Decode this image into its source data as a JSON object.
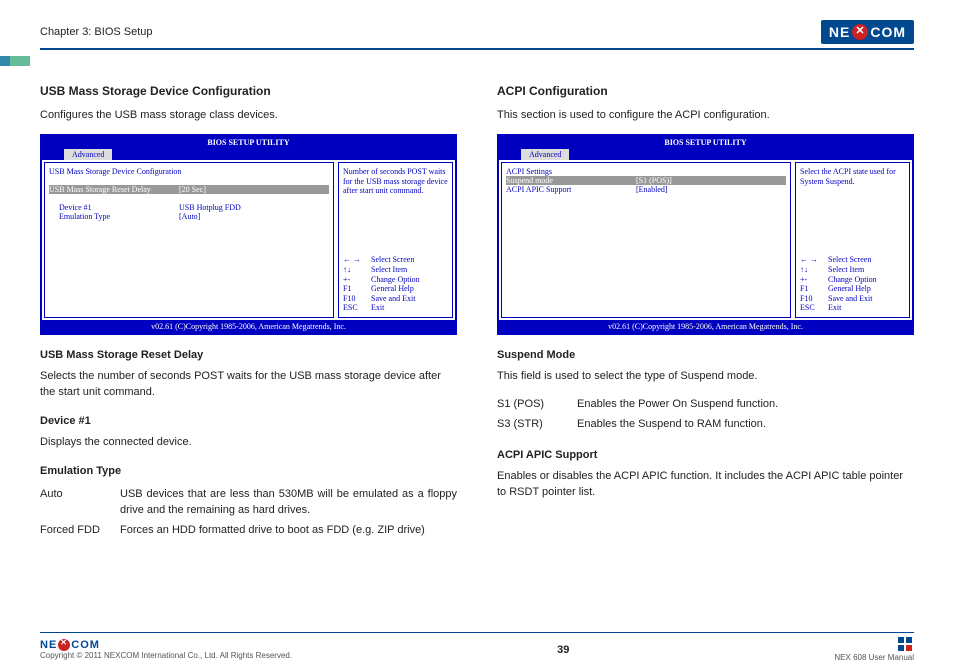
{
  "header": {
    "chapter": "Chapter 3: BIOS Setup",
    "brand": "NE COM"
  },
  "left": {
    "h1": "USB Mass Storage Device Configuration",
    "p1": "Configures the USB mass storage class devices.",
    "bios": {
      "title": "BIOS SETUP UTILITY",
      "tab": "Advanced",
      "section": "USB Mass Storage Device Configuration",
      "opt1_label": "USB Mass Storage Reset Delay",
      "opt1_val": "[20 Sec]",
      "dev_label": "Device #1",
      "dev_val": "USB Hotplug FDD",
      "emu_label": "Emulation Type",
      "emu_val": "[Auto]",
      "help": "Number of seconds POST waits for the USB mass storage device after start unit command.",
      "keys": {
        "a": "← →",
        "at": "Select Screen",
        "b": "↑↓",
        "bt": "Select Item",
        "c": "+-",
        "ct": "Change Option",
        "d": "F1",
        "dt": "General Help",
        "e": "F10",
        "et": "Save and Exit",
        "f": "ESC",
        "ft": "Exit"
      },
      "footer": "v02.61 (C)Copyright 1985-2006, American Megatrends, Inc."
    },
    "h2": "USB Mass Storage Reset Delay",
    "p2": "Selects the number of seconds POST waits for the USB mass storage device after the start unit command.",
    "h3": "Device #1",
    "p3": "Displays the connected device.",
    "h4": "Emulation Type",
    "tbl": {
      "r1a": "Auto",
      "r1b": "USB devices that are less than 530MB will be emulated as a floppy drive and the remaining as hard drives.",
      "r2a": "Forced FDD",
      "r2b": "Forces an HDD formatted drive to boot as FDD (e.g. ZIP drive)"
    }
  },
  "right": {
    "h1": "ACPI Configuration",
    "p1": "This section is used to configure the ACPI configuration.",
    "bios": {
      "title": "BIOS SETUP UTILITY",
      "tab": "Advanced",
      "section": "ACPI Settings",
      "opt1_label": "Suspend mode",
      "opt1_val": "[S1 (POS)]",
      "opt2_label": "ACPI APIC Support",
      "opt2_val": "[Enabled]",
      "help": "Select the ACPI state used for System Suspend.",
      "footer": "v02.61 (C)Copyright 1985-2006, American Megatrends, Inc."
    },
    "h2": "Suspend Mode",
    "p2": "This field is used to select the type of Suspend mode.",
    "tbl": {
      "r1a": "S1 (POS)",
      "r1b": "Enables the Power On Suspend function.",
      "r2a": "S3 (STR)",
      "r2b": "Enables the Suspend to RAM function."
    },
    "h3": "ACPI APIC Support",
    "p3": "Enables or disables the ACPI APIC function. It includes the ACPI APIC table pointer to RSDT pointer list."
  },
  "footer": {
    "copyright": "Copyright © 2011 NEXCOM International Co., Ltd. All Rights Reserved.",
    "pagenum": "39",
    "docname": "NEX 608 User Manual"
  }
}
